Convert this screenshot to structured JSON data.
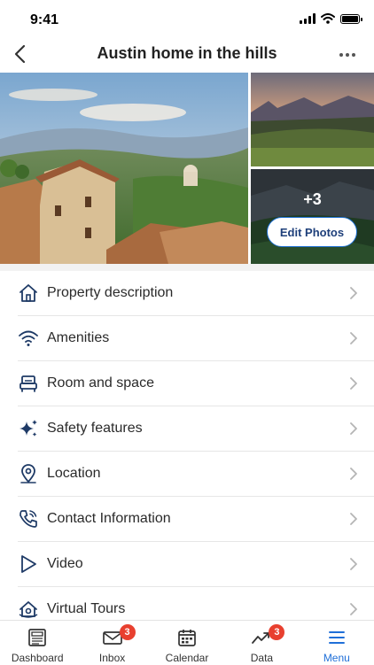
{
  "status_bar": {
    "time": "9:41"
  },
  "header": {
    "title": "Austin home in the hills"
  },
  "photos": {
    "extra_count": "+3",
    "edit_label": "Edit Photos"
  },
  "menu": [
    {
      "label": "Property description",
      "icon": "home-icon"
    },
    {
      "label": "Amenities",
      "icon": "wifi-icon"
    },
    {
      "label": "Room and space",
      "icon": "bed-icon"
    },
    {
      "label": "Safety features",
      "icon": "sparkles-icon"
    },
    {
      "label": "Location",
      "icon": "location-pin-icon"
    },
    {
      "label": "Contact Information",
      "icon": "phone-icon"
    },
    {
      "label": "Video",
      "icon": "play-icon"
    },
    {
      "label": "Virtual Tours",
      "icon": "virtual-tour-icon"
    }
  ],
  "tabbar": {
    "tabs": [
      {
        "label": "Dashboard",
        "icon": "newspaper-icon"
      },
      {
        "label": "Inbox",
        "icon": "mail-icon",
        "badge": "3"
      },
      {
        "label": "Calendar",
        "icon": "calendar-icon"
      },
      {
        "label": "Data",
        "icon": "trend-icon",
        "badge": "3"
      },
      {
        "label": "Menu",
        "icon": "menu-icon"
      }
    ],
    "active": "Menu"
  },
  "colors": {
    "accent": "#1f6fd8",
    "badge": "#e8402f",
    "text": "#2a2a2a"
  }
}
